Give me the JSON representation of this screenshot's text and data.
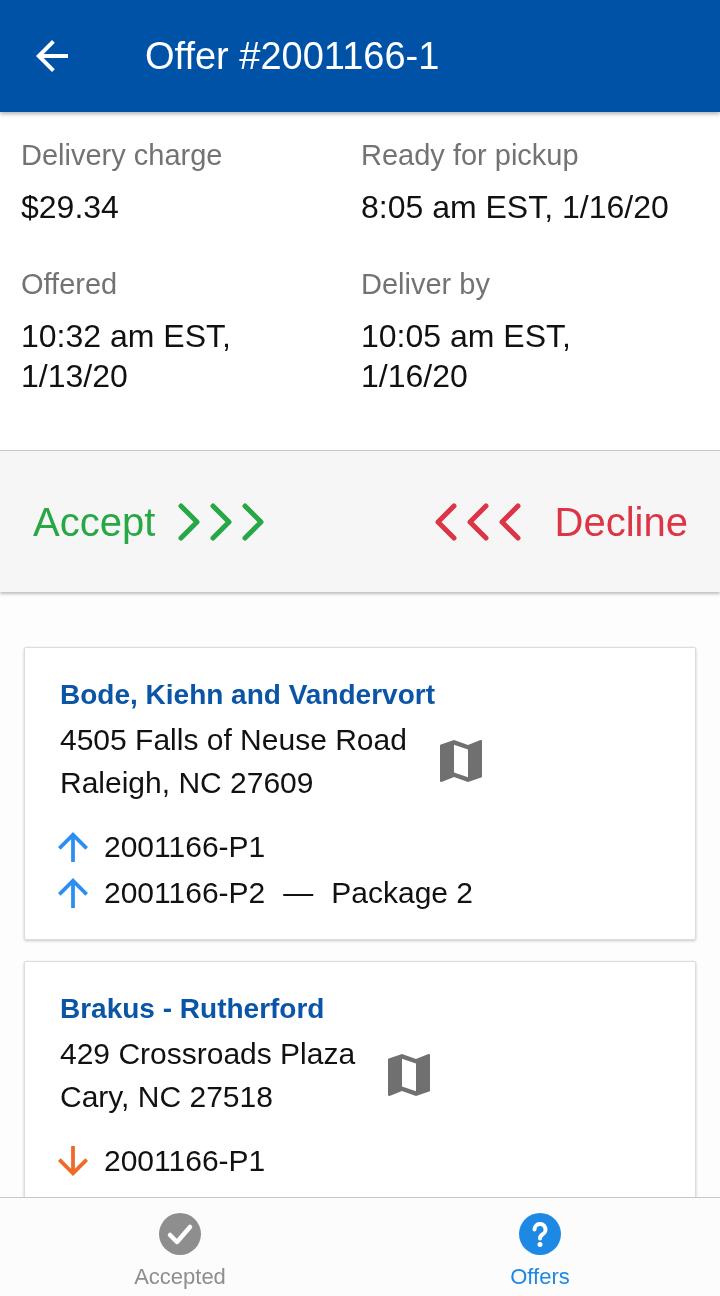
{
  "header": {
    "title": "Offer #2001166-1"
  },
  "details": [
    {
      "label": "Delivery charge",
      "value": "$29.34"
    },
    {
      "label": "Ready for pickup",
      "value": "8:05 am EST, 1/16/20"
    },
    {
      "label": "Offered",
      "value": "10:32 am EST, 1/13/20"
    },
    {
      "label": "Deliver by",
      "value": "10:05 am EST, 1/16/20"
    }
  ],
  "actions": [
    {
      "kind": "accept",
      "label": "Accept"
    },
    {
      "kind": "decline",
      "label": "Decline"
    }
  ],
  "stops": [
    {
      "name": "Bode, Kiehn and Vandervort",
      "address": [
        "4505 Falls of Neuse Road",
        "Raleigh, NC 27609"
      ],
      "packages": [
        {
          "kind": "pickup",
          "id": "2001166-P1"
        },
        {
          "kind": "pickup",
          "id": "2001166-P2",
          "separator": "—",
          "description": "Package 2"
        }
      ]
    },
    {
      "name": "Brakus - Rutherford",
      "address": [
        "429 Crossroads Plaza",
        "Cary, NC 27518"
      ],
      "packages": [
        {
          "kind": "dropoff",
          "id": "2001166-P1"
        }
      ]
    }
  ],
  "bottom_nav": [
    {
      "kind": "check",
      "label": "Accepted",
      "selected": false
    },
    {
      "kind": "help",
      "label": "Offers",
      "selected": true
    }
  ]
}
